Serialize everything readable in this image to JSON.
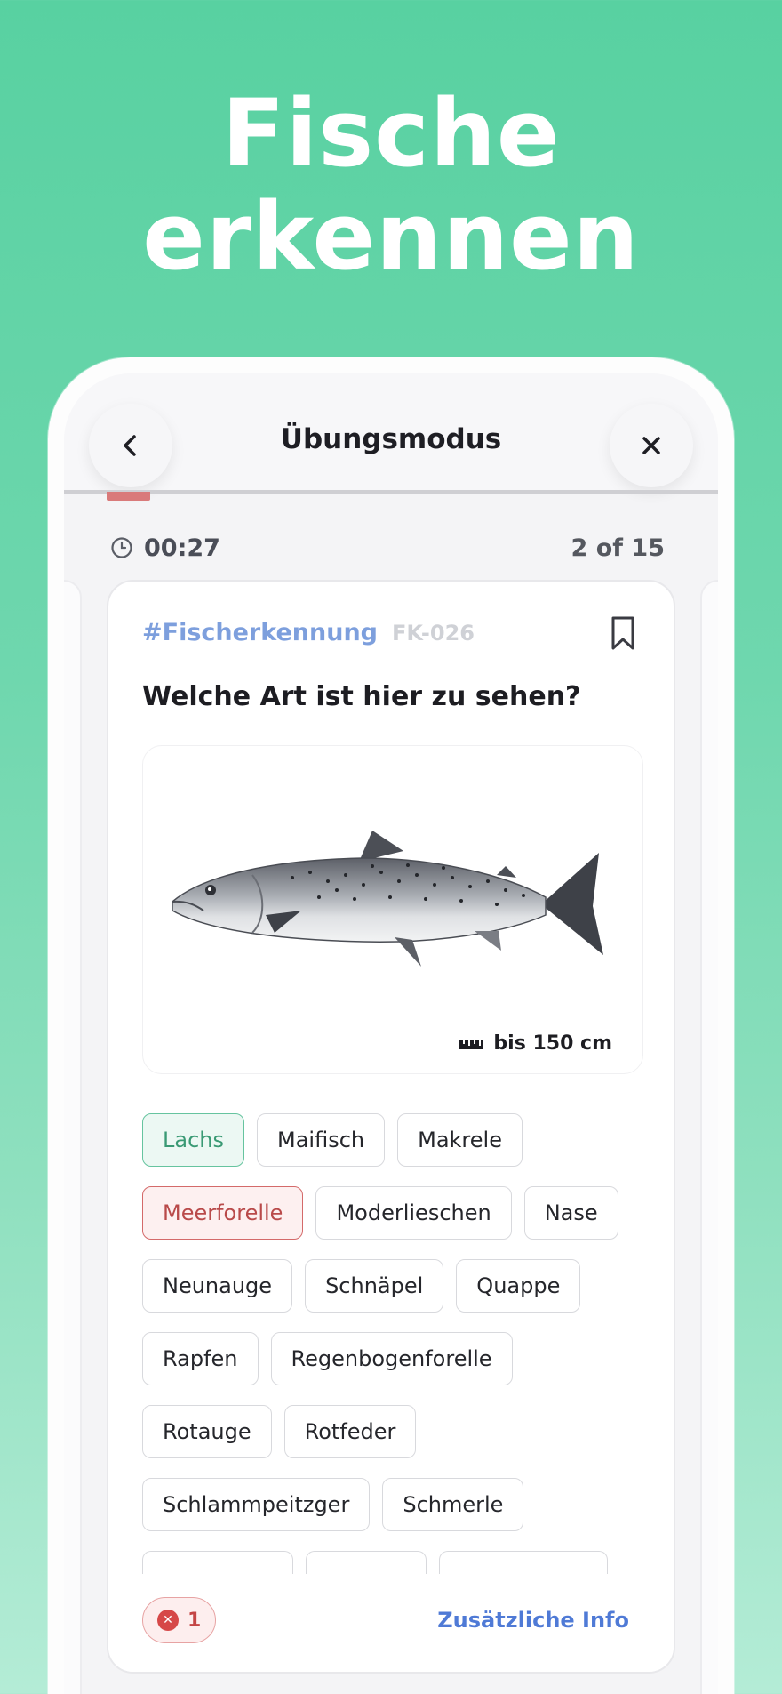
{
  "hero": {
    "line1": "Fische",
    "line2": "erkennen"
  },
  "header": {
    "title": "Übungsmodus",
    "back_icon": "chevron-left-icon",
    "close_icon": "close-icon"
  },
  "progress": {
    "fraction": 0.067
  },
  "status": {
    "timer": "00:27",
    "counter": "2 of 15"
  },
  "card": {
    "hashtag": "#Fischerkennung",
    "code": "FK-026",
    "question": "Welche Art ist hier zu sehen?",
    "size": "bis 150 cm"
  },
  "options": {
    "row1": [
      "Lachs",
      "Maifisch",
      "Makrele"
    ],
    "row2": [
      "Meerforelle",
      "Moderlieschen",
      "Nase"
    ],
    "row3": [
      "Neunauge",
      "Schnäpel",
      "Quappe"
    ],
    "row4": [
      "Rapfen",
      "Regenbogenforelle"
    ],
    "row5": [
      "Rotauge",
      "Rotfeder"
    ],
    "row6": [
      "Schlammpeitzger",
      "Schmerle"
    ],
    "correct": "Lachs",
    "wrong": "Meerforelle"
  },
  "footer": {
    "error_count": "1",
    "more_info": "Zusätzliche Info"
  },
  "colors": {
    "accent": "#58d1a1",
    "correct": "#3a9a74",
    "wrong": "#c44545",
    "link": "#4f7ad6"
  }
}
